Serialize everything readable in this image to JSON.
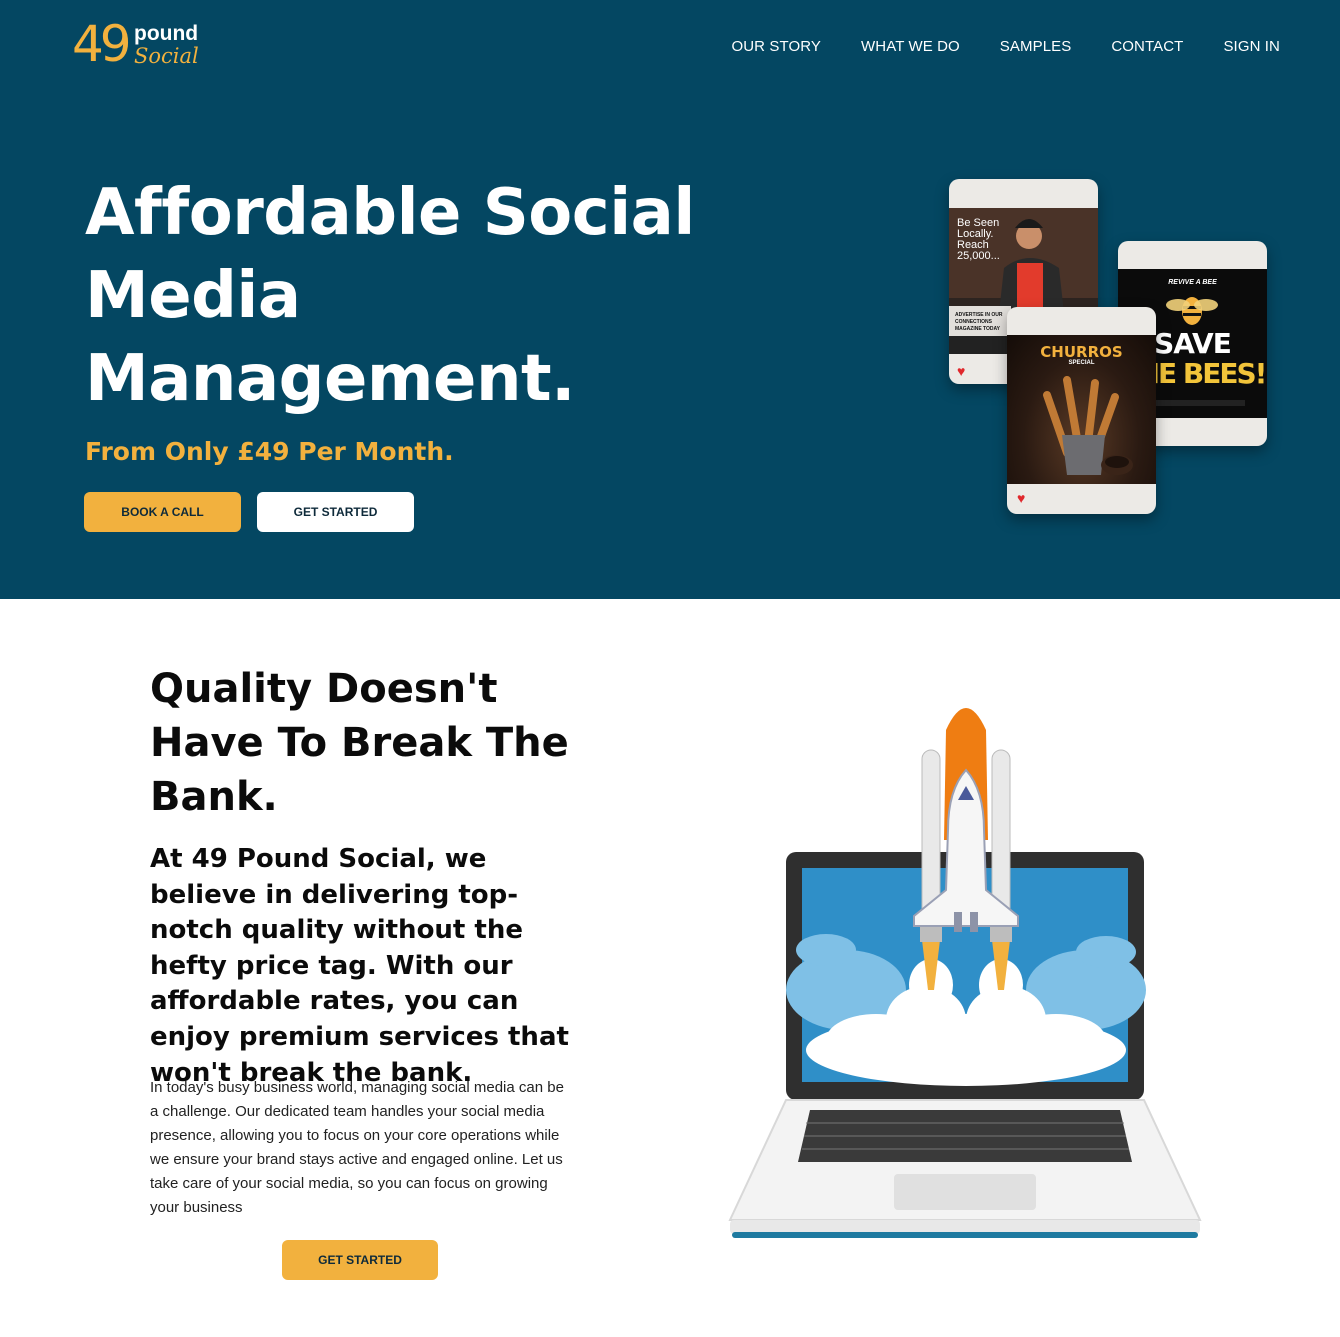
{
  "brand": {
    "number": "49",
    "word1": "pound",
    "word2": "Social",
    "accent_color": "#f2b13e",
    "hero_bg": "#044762"
  },
  "nav": {
    "items": [
      {
        "label": "OUR STORY"
      },
      {
        "label": "WHAT WE DO"
      },
      {
        "label": "SAMPLES"
      },
      {
        "label": "CONTACT"
      },
      {
        "label": "SIGN IN"
      }
    ]
  },
  "hero": {
    "title": "Affordable Social Media Management.",
    "subtitle": "From Only £49 Per Month.",
    "book_call_label": "BOOK A CALL",
    "get_started_label": "GET STARTED"
  },
  "posts": [
    {
      "name": "chef-post",
      "lines": [
        "Be Seen",
        "Locally.",
        "Reach",
        "25,000..."
      ],
      "footer": "ADVERTISE IN OUR CONNECTIONS MAGAZINE TODAY"
    },
    {
      "name": "bees-post",
      "kicker": "REVIVE A BEE",
      "headline1": "SAVE",
      "headline2": "THE BEES!"
    },
    {
      "name": "churros-post",
      "headline": "CHURROS",
      "sub": "SPECIAL"
    }
  ],
  "quality": {
    "title": "Quality Doesn't Have To Break The Bank.",
    "lead": "At 49 Pound Social, we believe in delivering top-notch quality without the hefty price tag. With our affordable rates, you can enjoy premium services that won't break the bank.",
    "body": "In today's busy business world, managing social media can be a challenge. Our dedicated team handles your social media presence, allowing you to focus on your core operations while we ensure your brand stays active and engaged online. Let us take care of your social media, so you can focus on growing your business",
    "cta_label": "GET STARTED"
  }
}
